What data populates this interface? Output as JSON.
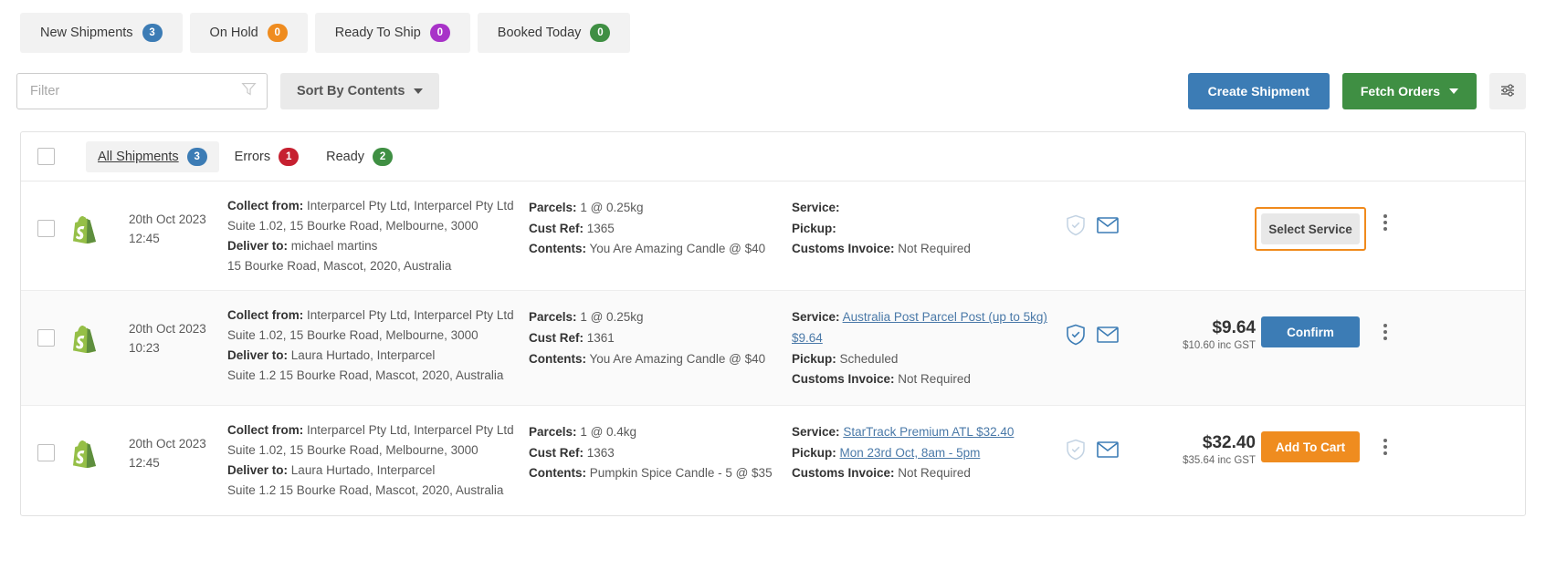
{
  "status_tabs": [
    {
      "label": "New Shipments",
      "count": "3",
      "color": "#3c7cb5"
    },
    {
      "label": "On Hold",
      "count": "0",
      "color": "#ef8c1f"
    },
    {
      "label": "Ready To Ship",
      "count": "0",
      "color": "#a832c8"
    },
    {
      "label": "Booked Today",
      "count": "0",
      "color": "#3f8f43"
    }
  ],
  "toolbar": {
    "filter_placeholder": "Filter",
    "filter_value": "",
    "funnel_icon": "funnel-icon",
    "sort_label": "Sort By Contents",
    "create_shipment_label": "Create Shipment",
    "fetch_orders_label": "Fetch Orders",
    "settings_icon": "sliders-icon"
  },
  "sub_tabs": [
    {
      "label": "All Shipments",
      "count": "3",
      "color": "#3c7cb5",
      "active": true
    },
    {
      "label": "Errors",
      "count": "1",
      "color": "#c62030",
      "active": false
    },
    {
      "label": "Ready",
      "count": "2",
      "color": "#3f8f43",
      "active": false
    }
  ],
  "rows": [
    {
      "logo_icon": "shopify-icon",
      "date": "20th Oct 2023",
      "time": "12:45",
      "collect_label": "Collect from:",
      "collect_name": "Interparcel Pty Ltd, Interparcel Pty Ltd",
      "collect_addr": "Suite 1.02, 15 Bourke Road, Melbourne, 3000",
      "deliver_label": "Deliver to:",
      "deliver_name": "michael martins",
      "deliver_addr": "15 Bourke Road, Mascot, 2020, Australia",
      "parcels_label": "Parcels:",
      "parcels_value": "1 @ 0.25kg",
      "custref_label": "Cust Ref:",
      "custref_value": "1365",
      "contents_label": "Contents:",
      "contents_value": "You Are Amazing Candle @ $40",
      "service_label": "Service:",
      "service_value": "",
      "service_is_link": false,
      "pickup_label": "Pickup:",
      "pickup_value": "",
      "pickup_is_link": false,
      "customs_label": "Customs Invoice:",
      "customs_value": "Not Required",
      "shield_icon": "shield-check-icon",
      "shield_active": false,
      "mail_icon": "envelope-icon",
      "price_main": "",
      "price_sub": "",
      "action_label": "Select Service",
      "action_style": "act-select",
      "action_highlighted": true,
      "kebab_icon": "kebab-menu-icon"
    },
    {
      "logo_icon": "shopify-icon",
      "date": "20th Oct 2023",
      "time": "10:23",
      "collect_label": "Collect from:",
      "collect_name": "Interparcel Pty Ltd, Interparcel Pty Ltd",
      "collect_addr": "Suite 1.02, 15 Bourke Road, Melbourne, 3000",
      "deliver_label": "Deliver to:",
      "deliver_name": "Laura Hurtado, Interparcel",
      "deliver_addr": "Suite 1.2 15 Bourke Road, Mascot, 2020, Australia",
      "parcels_label": "Parcels:",
      "parcels_value": "1 @ 0.25kg",
      "custref_label": "Cust Ref:",
      "custref_value": "1361",
      "contents_label": "Contents:",
      "contents_value": "You Are Amazing Candle @ $40",
      "service_label": "Service:",
      "service_value": "Australia Post Parcel Post (up to 5kg) $9.64",
      "service_is_link": true,
      "pickup_label": "Pickup:",
      "pickup_value": "Scheduled",
      "pickup_is_link": false,
      "customs_label": "Customs Invoice:",
      "customs_value": "Not Required",
      "shield_icon": "shield-check-icon",
      "shield_active": true,
      "mail_icon": "envelope-icon",
      "price_main": "$9.64",
      "price_sub": "$10.60 inc GST",
      "action_label": "Confirm",
      "action_style": "act-confirm",
      "action_highlighted": false,
      "kebab_icon": "kebab-menu-icon"
    },
    {
      "logo_icon": "shopify-icon",
      "date": "20th Oct 2023",
      "time": "12:45",
      "collect_label": "Collect from:",
      "collect_name": "Interparcel Pty Ltd, Interparcel Pty Ltd",
      "collect_addr": "Suite 1.02, 15 Bourke Road, Melbourne, 3000",
      "deliver_label": "Deliver to:",
      "deliver_name": "Laura Hurtado, Interparcel",
      "deliver_addr": "Suite 1.2 15 Bourke Road, Mascot, 2020, Australia",
      "parcels_label": "Parcels:",
      "parcels_value": "1 @ 0.4kg",
      "custref_label": "Cust Ref:",
      "custref_value": "1363",
      "contents_label": "Contents:",
      "contents_value": "Pumpkin Spice Candle - 5 @ $35",
      "service_label": "Service:",
      "service_value": "StarTrack Premium ATL $32.40",
      "service_is_link": true,
      "pickup_label": "Pickup:",
      "pickup_value": "Mon 23rd Oct, 8am - 5pm",
      "pickup_is_link": true,
      "customs_label": "Customs Invoice:",
      "customs_value": "Not Required",
      "shield_icon": "shield-check-icon",
      "shield_active": false,
      "mail_icon": "envelope-icon",
      "price_main": "$32.40",
      "price_sub": "$35.64 inc GST",
      "action_label": "Add To Cart",
      "action_style": "act-cart",
      "action_highlighted": false,
      "kebab_icon": "kebab-menu-icon"
    }
  ]
}
